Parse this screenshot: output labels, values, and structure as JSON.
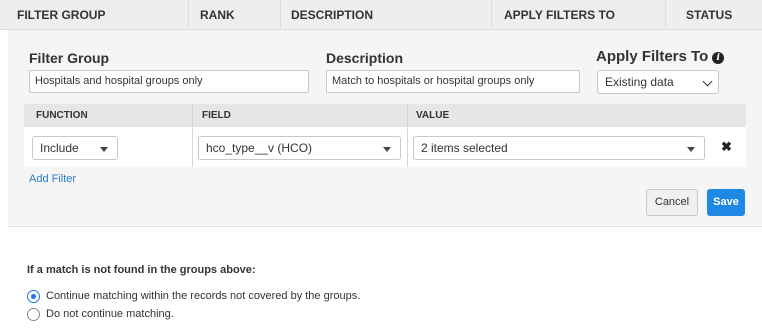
{
  "header": {
    "columns": [
      "FILTER GROUP",
      "RANK",
      "DESCRIPTION",
      "APPLY FILTERS TO",
      "STATUS"
    ]
  },
  "editor": {
    "filter_group_label": "Filter Group",
    "filter_group_value": "Hospitals and hospital groups only",
    "description_label": "Description",
    "description_value": "Match to hospitals or hospital groups only",
    "apply_filters_label": "Apply Filters To",
    "apply_filters_value": "Existing data",
    "table": {
      "headers": [
        "FUNCTION",
        "FIELD",
        "VALUE"
      ],
      "rows": [
        {
          "function": "Include",
          "field": "hco_type__v (HCO)",
          "value": "2 items selected"
        }
      ]
    },
    "add_filter_label": "Add Filter",
    "cancel_label": "Cancel",
    "save_label": "Save"
  },
  "no_match": {
    "title": "If a match is not found in the groups above:",
    "options": [
      {
        "label": "Continue matching within the records not covered by the groups.",
        "selected": true
      },
      {
        "label": "Do not continue matching.",
        "selected": false
      }
    ]
  },
  "colors": {
    "accent": "#1e88e5",
    "link": "#2b7bc6",
    "header_bg": "#eeeeee",
    "panel_bg": "#f5f5f5"
  }
}
